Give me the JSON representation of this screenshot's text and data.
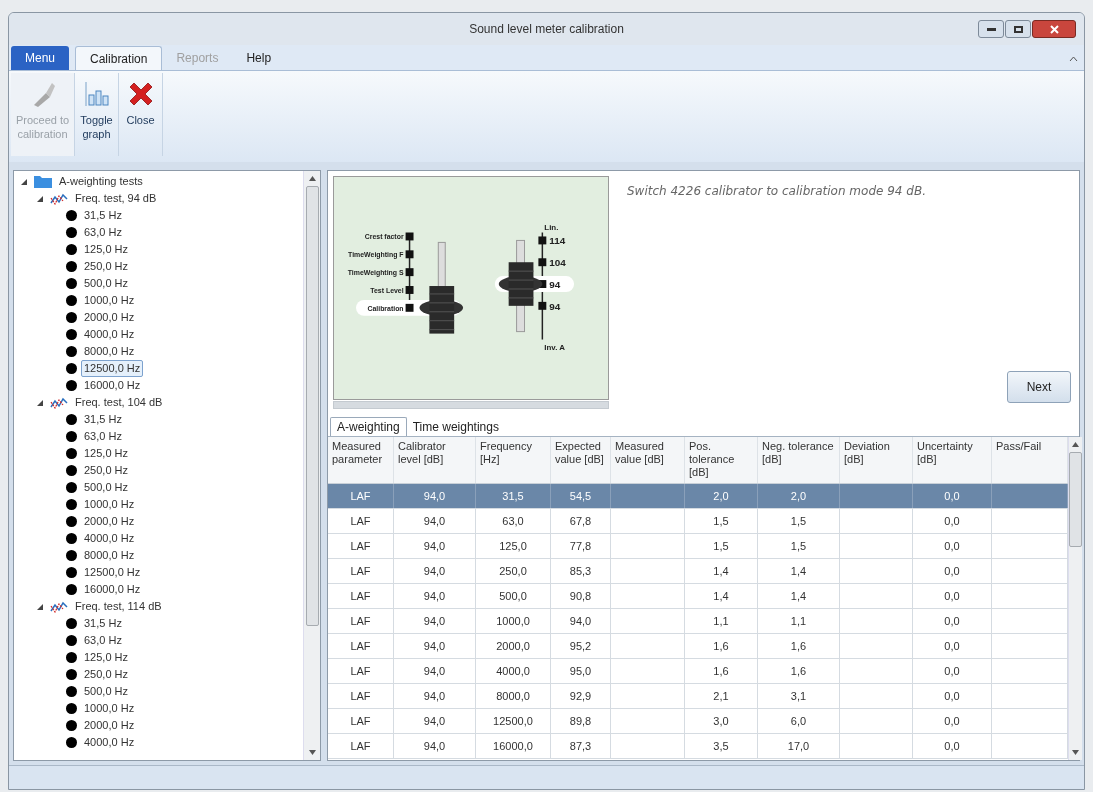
{
  "window": {
    "title": "Sound level meter calibration"
  },
  "ribbon_tabs": [
    {
      "label": "Menu",
      "kind": "menu"
    },
    {
      "label": "Calibration",
      "kind": "tab",
      "selected": true,
      "disabled": false
    },
    {
      "label": "Reports",
      "kind": "tab",
      "selected": false,
      "disabled": true
    },
    {
      "label": "Help",
      "kind": "tab",
      "selected": false,
      "disabled": false
    }
  ],
  "ribbon_buttons": [
    {
      "label": "Proceed to calibration",
      "kind": "proceed",
      "disabled": true
    },
    {
      "label": "Toggle graph",
      "kind": "graph",
      "disabled": false
    },
    {
      "label": "Close",
      "kind": "close",
      "disabled": false
    }
  ],
  "tree": {
    "label": "A-weighting tests",
    "kind": "folder",
    "expanded": true,
    "selected": false,
    "children": [
      {
        "label": "Freq. test, 94 dB",
        "kind": "test",
        "expanded": true,
        "selected": false,
        "children": [
          {
            "label": "31,5 Hz",
            "kind": "point",
            "selected": false
          },
          {
            "label": "63,0 Hz",
            "kind": "point",
            "selected": false
          },
          {
            "label": "125,0 Hz",
            "kind": "point",
            "selected": false
          },
          {
            "label": "250,0 Hz",
            "kind": "point",
            "selected": false
          },
          {
            "label": "500,0 Hz",
            "kind": "point",
            "selected": false
          },
          {
            "label": "1000,0 Hz",
            "kind": "point",
            "selected": false
          },
          {
            "label": "2000,0 Hz",
            "kind": "point",
            "selected": false
          },
          {
            "label": "4000,0 Hz",
            "kind": "point",
            "selected": false
          },
          {
            "label": "8000,0 Hz",
            "kind": "point",
            "selected": false
          },
          {
            "label": "12500,0 Hz",
            "kind": "point",
            "selected": true
          },
          {
            "label": "16000,0 Hz",
            "kind": "point",
            "selected": false
          }
        ]
      },
      {
        "label": "Freq. test, 104 dB",
        "kind": "test",
        "expanded": true,
        "selected": false,
        "children": [
          {
            "label": "31,5 Hz",
            "kind": "point",
            "selected": false
          },
          {
            "label": "63,0 Hz",
            "kind": "point",
            "selected": false
          },
          {
            "label": "125,0 Hz",
            "kind": "point",
            "selected": false
          },
          {
            "label": "250,0 Hz",
            "kind": "point",
            "selected": false
          },
          {
            "label": "500,0 Hz",
            "kind": "point",
            "selected": false
          },
          {
            "label": "1000,0 Hz",
            "kind": "point",
            "selected": false
          },
          {
            "label": "2000,0 Hz",
            "kind": "point",
            "selected": false
          },
          {
            "label": "4000,0 Hz",
            "kind": "point",
            "selected": false
          },
          {
            "label": "8000,0 Hz",
            "kind": "point",
            "selected": false
          },
          {
            "label": "12500,0 Hz",
            "kind": "point",
            "selected": false
          },
          {
            "label": "16000,0 Hz",
            "kind": "point",
            "selected": false
          }
        ]
      },
      {
        "label": "Freq. test, 114 dB",
        "kind": "test",
        "expanded": true,
        "selected": false,
        "children": [
          {
            "label": "31,5 Hz",
            "kind": "point",
            "selected": false
          },
          {
            "label": "63,0 Hz",
            "kind": "point",
            "selected": false
          },
          {
            "label": "125,0 Hz",
            "kind": "point",
            "selected": false
          },
          {
            "label": "250,0 Hz",
            "kind": "point",
            "selected": false
          },
          {
            "label": "500,0 Hz",
            "kind": "point",
            "selected": false
          },
          {
            "label": "1000,0 Hz",
            "kind": "point",
            "selected": false
          },
          {
            "label": "2000,0 Hz",
            "kind": "point",
            "selected": false
          },
          {
            "label": "4000,0 Hz",
            "kind": "point",
            "selected": false
          }
        ]
      }
    ]
  },
  "illustration": {
    "left_positions": [
      {
        "label": "Crest factor",
        "selected": false
      },
      {
        "label": "TimeWeighting F",
        "selected": false
      },
      {
        "label": "TimeWeighting S",
        "selected": false
      },
      {
        "label": "Test Level",
        "selected": false
      },
      {
        "label": "Calibration",
        "selected": true
      }
    ],
    "right_top": "Lin.",
    "right_positions": [
      {
        "label": "114",
        "selected": false
      },
      {
        "label": "104",
        "selected": false
      },
      {
        "label": "94",
        "selected": true
      },
      {
        "label": "94",
        "selected": false
      }
    ],
    "right_bottom": "Inv. A"
  },
  "instruction": "Switch 4226 calibrator to calibration mode 94 dB.",
  "next_button": "Next",
  "tabs": [
    {
      "label": "A-weighting",
      "selected": true
    },
    {
      "label": "Time weightings",
      "selected": false
    }
  ],
  "table": {
    "columns": [
      "Measured parameter",
      "Calibrator level [dB]",
      "Frequency [Hz]",
      "Expected value [dB]",
      "Measured value [dB]",
      "Pos. tolerance [dB]",
      "Neg. tolerance [dB]",
      "Deviation [dB]",
      "Uncertainty [dB]",
      "Pass/Fail"
    ],
    "rows": [
      {
        "selected": true,
        "cells": [
          "LAF",
          "94,0",
          "31,5",
          "54,5",
          null,
          "2,0",
          "2,0",
          null,
          "0,0",
          null
        ]
      },
      {
        "selected": false,
        "cells": [
          "LAF",
          "94,0",
          "63,0",
          "67,8",
          null,
          "1,5",
          "1,5",
          null,
          "0,0",
          null
        ]
      },
      {
        "selected": false,
        "cells": [
          "LAF",
          "94,0",
          "125,0",
          "77,8",
          null,
          "1,5",
          "1,5",
          null,
          "0,0",
          null
        ]
      },
      {
        "selected": false,
        "cells": [
          "LAF",
          "94,0",
          "250,0",
          "85,3",
          null,
          "1,4",
          "1,4",
          null,
          "0,0",
          null
        ]
      },
      {
        "selected": false,
        "cells": [
          "LAF",
          "94,0",
          "500,0",
          "90,8",
          null,
          "1,4",
          "1,4",
          null,
          "0,0",
          null
        ]
      },
      {
        "selected": false,
        "cells": [
          "LAF",
          "94,0",
          "1000,0",
          "94,0",
          null,
          "1,1",
          "1,1",
          null,
          "0,0",
          null
        ]
      },
      {
        "selected": false,
        "cells": [
          "LAF",
          "94,0",
          "2000,0",
          "95,2",
          null,
          "1,6",
          "1,6",
          null,
          "0,0",
          null
        ]
      },
      {
        "selected": false,
        "cells": [
          "LAF",
          "94,0",
          "4000,0",
          "95,0",
          null,
          "1,6",
          "1,6",
          null,
          "0,0",
          null
        ]
      },
      {
        "selected": false,
        "cells": [
          "LAF",
          "94,0",
          "8000,0",
          "92,9",
          null,
          "2,1",
          "3,1",
          null,
          "0,0",
          null
        ]
      },
      {
        "selected": false,
        "cells": [
          "LAF",
          "94,0",
          "12500,0",
          "89,8",
          null,
          "3,0",
          "6,0",
          null,
          "0,0",
          null
        ]
      },
      {
        "selected": false,
        "cells": [
          "LAF",
          "94,0",
          "16000,0",
          "87,3",
          null,
          "3,5",
          "17,0",
          null,
          "0,0",
          null
        ]
      }
    ]
  }
}
